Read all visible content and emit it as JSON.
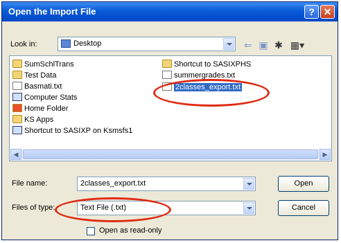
{
  "dialog": {
    "title": "Open the Import File",
    "help_glyph": "?",
    "close_glyph": "✕"
  },
  "look_in": {
    "label": "Look in:",
    "value": "Desktop"
  },
  "toolbar": {
    "back_icon": "back-arrow-icon",
    "up_icon": "up-folder-icon",
    "new_folder_icon": "new-folder-icon",
    "views_icon": "views-menu-icon"
  },
  "files": [
    {
      "name": "SumSchlTrans",
      "icon": "folder-icon"
    },
    {
      "name": "Test Data",
      "icon": "folder-icon"
    },
    {
      "name": "Basmati.txt",
      "icon": "text-file-icon"
    },
    {
      "name": "Computer Stats",
      "icon": "shortcut-icon"
    },
    {
      "name": "Home Folder",
      "icon": "home-folder-icon"
    },
    {
      "name": "KS Apps",
      "icon": "folder-icon"
    },
    {
      "name": "Shortcut to SASIXP on Ksmsfs1",
      "icon": "shortcut-icon"
    },
    {
      "name": "Shortcut to SASIXPHS",
      "icon": "shortcut-icon"
    },
    {
      "name": "summergrades.txt",
      "icon": "text-file-icon"
    },
    {
      "name": "2classes_export.txt",
      "icon": "text-file-icon",
      "selected": true
    }
  ],
  "file_name": {
    "label": "File name:",
    "value": "2classes_export.txt"
  },
  "file_type": {
    "label": "Files of type:",
    "value": "Text File (.txt)"
  },
  "open_readonly": {
    "label": "Open as read-only",
    "checked": false
  },
  "buttons": {
    "open": "Open",
    "cancel": "Cancel"
  },
  "annotation_color": "#e02a12"
}
